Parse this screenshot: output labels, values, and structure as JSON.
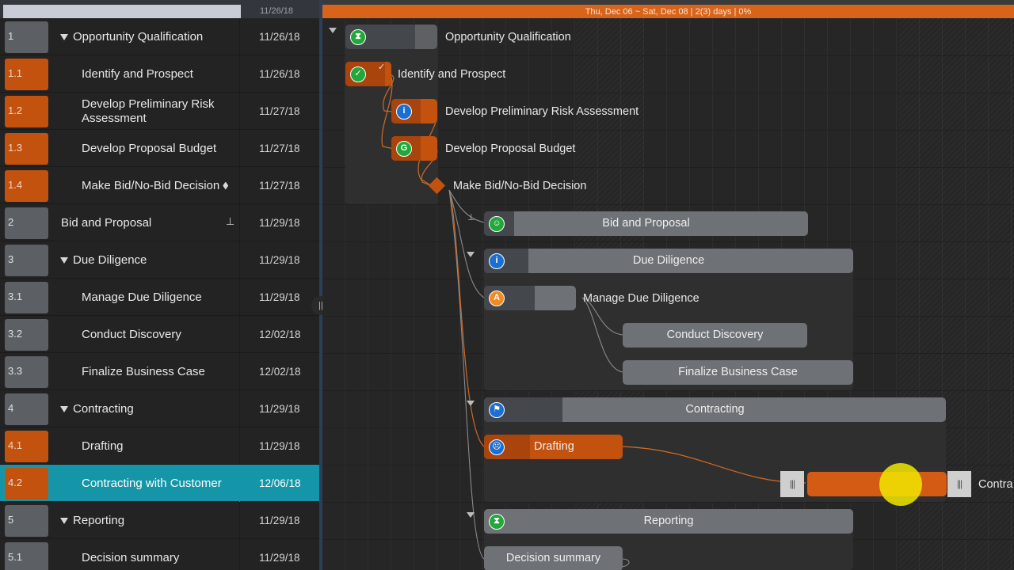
{
  "header": {
    "list_date": "11/26/18",
    "timeline_info": "Thu, Dec 06 ~ Sat, Dec 08  |  2(3) days  |  0%"
  },
  "tasks": [
    {
      "id": "1",
      "name": "Opportunity Qualification",
      "date": "11/26/18",
      "kind": "group",
      "color": "gray"
    },
    {
      "id": "1.1",
      "name": "Identify and Prospect",
      "date": "11/26/18",
      "kind": "task",
      "color": "orange"
    },
    {
      "id": "1.2",
      "name": "Develop Preliminary Risk Assessment",
      "date": "11/27/18",
      "kind": "task",
      "color": "orange"
    },
    {
      "id": "1.3",
      "name": "Develop Proposal Budget",
      "date": "11/27/18",
      "kind": "task",
      "color": "orange"
    },
    {
      "id": "1.4",
      "name": "Make Bid/No-Bid Decision",
      "date": "11/27/18",
      "kind": "milestone",
      "color": "orange"
    },
    {
      "id": "2",
      "name": "Bid and Proposal",
      "date": "11/29/18",
      "kind": "subproject",
      "color": "gray"
    },
    {
      "id": "3",
      "name": "Due Diligence",
      "date": "11/29/18",
      "kind": "group",
      "color": "gray"
    },
    {
      "id": "3.1",
      "name": "Manage Due Diligence",
      "date": "11/29/18",
      "kind": "task",
      "color": "gray"
    },
    {
      "id": "3.2",
      "name": "Conduct Discovery",
      "date": "12/02/18",
      "kind": "task",
      "color": "gray"
    },
    {
      "id": "3.3",
      "name": "Finalize Business Case",
      "date": "12/02/18",
      "kind": "task",
      "color": "gray"
    },
    {
      "id": "4",
      "name": "Contracting",
      "date": "11/29/18",
      "kind": "group",
      "color": "gray"
    },
    {
      "id": "4.1",
      "name": "Drafting",
      "date": "11/29/18",
      "kind": "task",
      "color": "orange"
    },
    {
      "id": "4.2",
      "name": "Contracting with Customer",
      "date": "12/06/18",
      "kind": "task",
      "color": "orange",
      "selected": true
    },
    {
      "id": "5",
      "name": "Reporting",
      "date": "11/29/18",
      "kind": "group",
      "color": "gray"
    },
    {
      "id": "5.1",
      "name": "Decision summary",
      "date": "11/29/18",
      "kind": "task",
      "color": "gray"
    }
  ],
  "gantt": {
    "labels": {
      "opportunity": "Opportunity Qualification",
      "identify": "Identify and Prospect",
      "risk": "Develop Preliminary Risk Assessment",
      "budget": "Develop Proposal Budget",
      "decision": "Make Bid/No-Bid Decision",
      "bid": "Bid and Proposal",
      "due": "Due Diligence",
      "manage": "Manage Due Diligence",
      "discovery": "Conduct Discovery",
      "finalize": "Finalize Business Case",
      "contracting": "Contracting",
      "drafting": "Drafting",
      "customer_clipped": "Contra",
      "reporting": "Reporting",
      "summary": "Decision summary"
    },
    "icons": {
      "opportunity": "hourglass-icon",
      "identify": "check-icon",
      "risk": "info-icon",
      "budget": "g-letter-icon",
      "bid": "smiley-icon",
      "due": "info-icon",
      "manage": "a-letter-icon",
      "contracting": "flag-icon",
      "drafting": "sad-face-icon",
      "reporting": "hourglass-icon"
    },
    "icon_glyphs": {
      "hourglass": "⧗",
      "check": "✓",
      "info": "i",
      "g": "G",
      "a": "A",
      "smiley": "☺",
      "flag": "⚑",
      "sad": "☹",
      "handle": "|||",
      "splitter": "||",
      "subproject": "⊥"
    }
  },
  "colors": {
    "accent_orange": "#c4520f",
    "selection": "#1596a8",
    "timeline_bar": "#d8641b",
    "icon_green": "#22a83a",
    "icon_blue": "#1c6fd1"
  }
}
